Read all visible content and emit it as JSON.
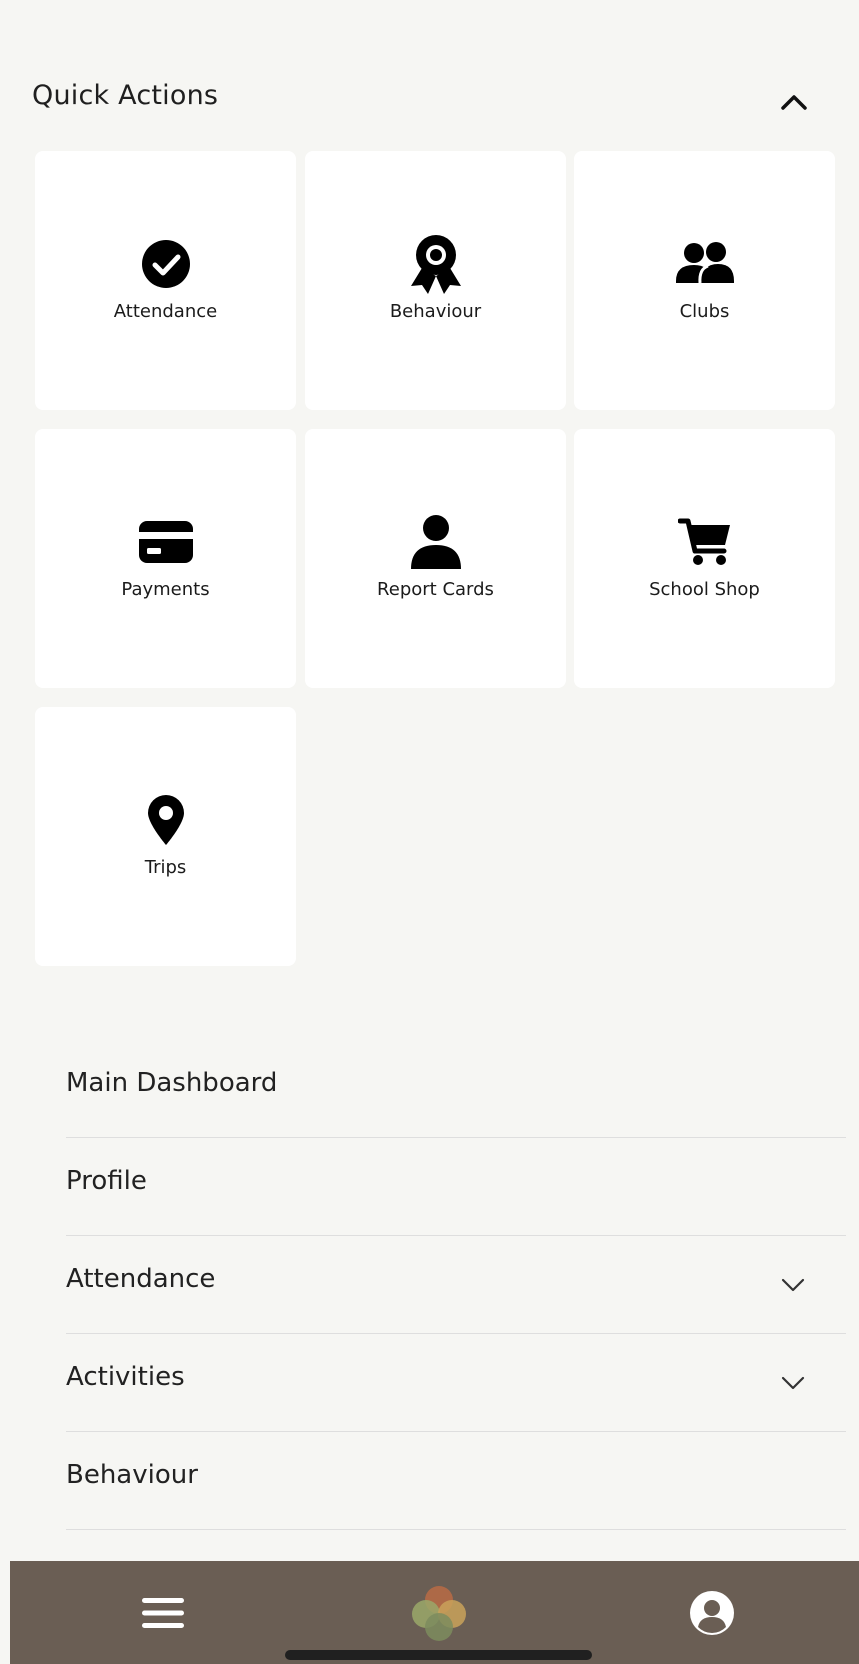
{
  "header": {
    "title": "Quick Actions",
    "collapse_icon": "chevron-up-icon"
  },
  "quick_actions": [
    {
      "label": "Attendance",
      "icon": "check-circle-icon"
    },
    {
      "label": "Behaviour",
      "icon": "award-ribbon-icon"
    },
    {
      "label": "Clubs",
      "icon": "users-group-icon"
    },
    {
      "label": "Payments",
      "icon": "credit-card-icon"
    },
    {
      "label": "Report Cards",
      "icon": "user-icon"
    },
    {
      "label": "School Shop",
      "icon": "shopping-cart-icon"
    },
    {
      "label": "Trips",
      "icon": "map-pin-icon"
    }
  ],
  "menu": {
    "items": [
      {
        "label": "Main Dashboard",
        "expandable": false
      },
      {
        "label": "Profile",
        "expandable": false
      },
      {
        "label": "Attendance",
        "expandable": true
      },
      {
        "label": "Activities",
        "expandable": true
      },
      {
        "label": "Behaviour",
        "expandable": false
      }
    ]
  },
  "tabbar": {
    "background": "#6a5e54",
    "left_icon": "menu-icon",
    "center_icon": "clover-logo-icon",
    "right_icon": "account-icon"
  },
  "colors": {
    "page_background": "#f6f6f3",
    "tile_background": "#ffffff",
    "text": "#1b1b1b"
  }
}
